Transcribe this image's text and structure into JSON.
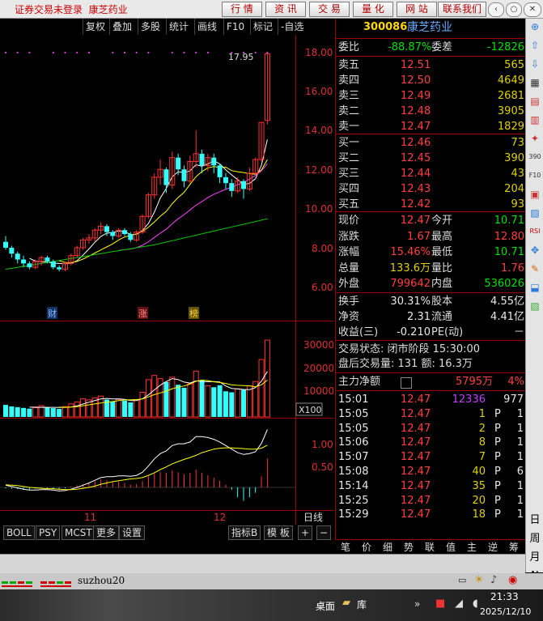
{
  "titlebar": {
    "status": "证券交易未登录",
    "stock_name": "康芝药业",
    "nav": [
      "行 情",
      "资 讯",
      "交 易",
      "量 化",
      "网 站",
      "联系我们"
    ],
    "win_controls": [
      "‹",
      "○",
      "□",
      "✕"
    ]
  },
  "toolbar": {
    "items": [
      "复权",
      "叠加",
      "多股",
      "统计",
      "画线",
      "F10",
      "标记",
      "-自选"
    ]
  },
  "chart": {
    "price_axis": [
      "18.00",
      "16.00",
      "14.00",
      "12.00",
      "10.00",
      "8.00",
      "6.00"
    ],
    "peak_label": "17.95",
    "markers": [
      "财",
      "涨",
      "榜"
    ],
    "volume_axis": [
      "30000",
      "20000",
      "10000"
    ],
    "volume_unit": "X100",
    "macd_axis": [
      "1.00",
      "0.50"
    ],
    "month_labels": [
      "11",
      "12"
    ],
    "period": "日线"
  },
  "chart_data": {
    "type": "candlestick",
    "candles": [
      {
        "o": 8.3,
        "c": 8.0,
        "h": 8.6,
        "l": 7.9
      },
      {
        "o": 8.0,
        "c": 7.7,
        "h": 8.1,
        "l": 7.5
      },
      {
        "o": 7.7,
        "c": 7.4,
        "h": 7.8,
        "l": 7.2
      },
      {
        "o": 7.4,
        "c": 7.2,
        "h": 7.6,
        "l": 7.0
      },
      {
        "o": 7.2,
        "c": 7.0,
        "h": 7.3,
        "l": 6.9
      },
      {
        "o": 7.0,
        "c": 7.3,
        "h": 7.4,
        "l": 6.9
      },
      {
        "o": 7.3,
        "c": 7.5,
        "h": 7.6,
        "l": 7.1
      },
      {
        "o": 7.5,
        "c": 7.3,
        "h": 7.6,
        "l": 7.2
      },
      {
        "o": 7.3,
        "c": 7.0,
        "h": 7.4,
        "l": 6.9
      },
      {
        "o": 7.0,
        "c": 6.9,
        "h": 7.1,
        "l": 6.8
      },
      {
        "o": 6.9,
        "c": 7.2,
        "h": 7.3,
        "l": 6.8
      },
      {
        "o": 7.2,
        "c": 7.6,
        "h": 7.7,
        "l": 7.1
      },
      {
        "o": 7.6,
        "c": 8.0,
        "h": 8.1,
        "l": 7.5
      },
      {
        "o": 8.0,
        "c": 8.4,
        "h": 8.5,
        "l": 7.9
      },
      {
        "o": 8.4,
        "c": 8.5,
        "h": 8.7,
        "l": 8.2
      },
      {
        "o": 8.5,
        "c": 8.9,
        "h": 9.0,
        "l": 8.3
      },
      {
        "o": 8.9,
        "c": 9.1,
        "h": 9.3,
        "l": 8.7
      },
      {
        "o": 9.1,
        "c": 8.8,
        "h": 9.2,
        "l": 8.6
      },
      {
        "o": 8.8,
        "c": 8.6,
        "h": 8.9,
        "l": 8.4
      },
      {
        "o": 8.6,
        "c": 8.9,
        "h": 9.0,
        "l": 8.5
      },
      {
        "o": 8.9,
        "c": 8.7,
        "h": 9.0,
        "l": 8.6
      },
      {
        "o": 8.7,
        "c": 8.4,
        "h": 8.8,
        "l": 8.3
      },
      {
        "o": 8.4,
        "c": 8.8,
        "h": 8.9,
        "l": 8.3
      },
      {
        "o": 8.8,
        "c": 9.6,
        "h": 9.7,
        "l": 8.7
      },
      {
        "o": 9.6,
        "c": 10.7,
        "h": 10.8,
        "l": 9.5
      },
      {
        "o": 10.7,
        "c": 11.6,
        "h": 11.8,
        "l": 10.5
      },
      {
        "o": 11.6,
        "c": 12.0,
        "h": 12.5,
        "l": 11.2
      },
      {
        "o": 12.0,
        "c": 11.2,
        "h": 12.1,
        "l": 10.8
      },
      {
        "o": 11.2,
        "c": 12.6,
        "h": 12.9,
        "l": 11.0
      },
      {
        "o": 12.6,
        "c": 12.0,
        "h": 12.8,
        "l": 11.7
      },
      {
        "o": 12.0,
        "c": 11.4,
        "h": 12.2,
        "l": 11.1
      },
      {
        "o": 11.4,
        "c": 12.4,
        "h": 12.7,
        "l": 11.3
      },
      {
        "o": 12.4,
        "c": 12.8,
        "h": 14.0,
        "l": 12.1
      },
      {
        "o": 12.8,
        "c": 12.2,
        "h": 13.0,
        "l": 11.8
      },
      {
        "o": 12.2,
        "c": 12.6,
        "h": 12.8,
        "l": 11.9
      },
      {
        "o": 12.6,
        "c": 12.2,
        "h": 12.8,
        "l": 11.8
      },
      {
        "o": 12.2,
        "c": 11.6,
        "h": 12.3,
        "l": 11.3
      },
      {
        "o": 11.6,
        "c": 11.3,
        "h": 11.8,
        "l": 11.0
      },
      {
        "o": 11.3,
        "c": 10.9,
        "h": 11.5,
        "l": 10.6
      },
      {
        "o": 10.9,
        "c": 11.4,
        "h": 11.6,
        "l": 10.8
      },
      {
        "o": 11.4,
        "c": 11.0,
        "h": 11.5,
        "l": 10.5
      },
      {
        "o": 11.0,
        "c": 11.8,
        "h": 12.1,
        "l": 10.9
      },
      {
        "o": 11.8,
        "c": 12.5,
        "h": 12.6,
        "l": 11.7
      },
      {
        "o": 12.5,
        "c": 14.4,
        "h": 14.4,
        "l": 12.4
      },
      {
        "o": 14.5,
        "c": 17.9,
        "h": 17.95,
        "l": 14.3
      }
    ],
    "volumes": [
      4800,
      4200,
      3900,
      3600,
      3300,
      4000,
      4500,
      3800,
      3500,
      3200,
      4100,
      5200,
      6000,
      7200,
      6800,
      7600,
      8300,
      6900,
      6200,
      7000,
      6500,
      5800,
      6900,
      9800,
      14800,
      16500,
      15200,
      13900,
      15800,
      12800,
      11600,
      13200,
      18200,
      14600,
      12400,
      11800,
      12600,
      10200,
      9800,
      11200,
      10800,
      12300,
      14100,
      22800,
      30500
    ],
    "vol_axis_max": 36000,
    "macd_hist": [
      -0.02,
      -0.03,
      -0.04,
      -0.05,
      -0.05,
      -0.03,
      -0.01,
      -0.02,
      -0.04,
      -0.05,
      -0.02,
      0.02,
      0.05,
      0.08,
      0.1,
      0.14,
      0.18,
      0.16,
      0.12,
      0.13,
      0.1,
      0.06,
      0.08,
      0.15,
      0.25,
      0.32,
      0.35,
      0.33,
      0.38,
      0.34,
      0.3,
      0.33,
      0.4,
      0.32,
      0.27,
      0.22,
      0.15,
      0.06,
      -0.05,
      -0.22,
      -0.3,
      -0.22,
      -0.12,
      0.25,
      0.65
    ],
    "dif": [
      0.05,
      0.02,
      -0.01,
      -0.04,
      -0.06,
      -0.06,
      -0.05,
      -0.05,
      -0.06,
      -0.08,
      -0.07,
      -0.04,
      0.0,
      0.05,
      0.1,
      0.16,
      0.22,
      0.24,
      0.24,
      0.26,
      0.26,
      0.25,
      0.27,
      0.34,
      0.48,
      0.64,
      0.76,
      0.82,
      0.94,
      0.98,
      0.98,
      1.02,
      1.14,
      1.14,
      1.12,
      1.08,
      1.02,
      0.94,
      0.86,
      0.78,
      0.74,
      0.76,
      0.8,
      0.99,
      1.3
    ],
    "dea": [
      0.06,
      0.05,
      0.04,
      0.02,
      0.0,
      -0.01,
      -0.02,
      -0.03,
      -0.03,
      -0.04,
      -0.05,
      -0.05,
      -0.04,
      -0.02,
      0.0,
      0.03,
      0.07,
      0.1,
      0.13,
      0.15,
      0.17,
      0.19,
      0.2,
      0.22,
      0.27,
      0.33,
      0.4,
      0.46,
      0.53,
      0.58,
      0.63,
      0.67,
      0.72,
      0.78,
      0.82,
      0.86,
      0.88,
      0.89,
      0.89,
      0.88,
      0.87,
      0.86,
      0.86,
      0.88,
      0.95
    ]
  },
  "quote": {
    "code": "300086",
    "name": "康芝药业",
    "weibi_label": "委比",
    "weibi": "-88.87%",
    "weicha_label": "委差",
    "weicha": "-12826",
    "asks": [
      {
        "label": "卖五",
        "price": "12.51",
        "vol": "565"
      },
      {
        "label": "卖四",
        "price": "12.50",
        "vol": "4649"
      },
      {
        "label": "卖三",
        "price": "12.49",
        "vol": "2681"
      },
      {
        "label": "卖二",
        "price": "12.48",
        "vol": "3905"
      },
      {
        "label": "卖一",
        "price": "12.47",
        "vol": "1829"
      }
    ],
    "bids": [
      {
        "label": "买一",
        "price": "12.46",
        "vol": "73"
      },
      {
        "label": "买二",
        "price": "12.45",
        "vol": "390"
      },
      {
        "label": "买三",
        "price": "12.44",
        "vol": "43"
      },
      {
        "label": "买四",
        "price": "12.43",
        "vol": "204"
      },
      {
        "label": "买五",
        "price": "12.42",
        "vol": "93"
      }
    ],
    "stats": [
      {
        "l1": "现价",
        "v1": "12.47",
        "l2": "今开",
        "v2": "10.71",
        "c1": "red",
        "c2": "green"
      },
      {
        "l1": "涨跌",
        "v1": "1.67",
        "l2": "最高",
        "v2": "12.80",
        "c1": "red",
        "c2": "red"
      },
      {
        "l1": "涨幅",
        "v1": "15.46%",
        "l2": "最低",
        "v2": "10.71",
        "c1": "red",
        "c2": "green"
      },
      {
        "l1": "总量",
        "v1": "133.6万",
        "l2": "量比",
        "v2": "1.76",
        "c1": "yellow",
        "c2": "red"
      },
      {
        "l1": "外盘",
        "v1": "799642",
        "l2": "内盘",
        "v2": "536026",
        "c1": "red",
        "c2": "green"
      }
    ],
    "fin": [
      {
        "l1": "换手",
        "v1": "30.31%",
        "l2": "股本",
        "v2": "4.55亿"
      },
      {
        "l1": "净资",
        "v1": "2.31",
        "l2": "流通",
        "v2": "4.41亿"
      },
      {
        "l1": "收益(三)",
        "v1": "-0.210",
        "l2": "PE(动)",
        "v2": "－"
      }
    ],
    "trade_state": "交易状态: 闭市阶段 15:30:00",
    "after_hours": "盘后交易量: 131  额: 16.3万",
    "main_net_label": "主力净额",
    "main_net": "5795万",
    "main_net_pct": "4%",
    "ticks": [
      {
        "t": "15:01",
        "p": "12.47",
        "v": "12336",
        "f": "",
        "n": "977",
        "vc": "purple"
      },
      {
        "t": "15:05",
        "p": "12.47",
        "v": "1",
        "f": "P",
        "n": "1",
        "vc": "yellow"
      },
      {
        "t": "15:05",
        "p": "12.47",
        "v": "2",
        "f": "P",
        "n": "1",
        "vc": "yellow"
      },
      {
        "t": "15:06",
        "p": "12.47",
        "v": "8",
        "f": "P",
        "n": "1",
        "vc": "yellow"
      },
      {
        "t": "15:07",
        "p": "12.47",
        "v": "7",
        "f": "P",
        "n": "1",
        "vc": "yellow"
      },
      {
        "t": "15:08",
        "p": "12.47",
        "v": "40",
        "f": "P",
        "n": "6",
        "vc": "yellow"
      },
      {
        "t": "15:14",
        "p": "12.47",
        "v": "35",
        "f": "P",
        "n": "1",
        "vc": "yellow"
      },
      {
        "t": "15:25",
        "p": "12.47",
        "v": "20",
        "f": "P",
        "n": "1",
        "vc": "yellow"
      },
      {
        "t": "15:29",
        "p": "12.47",
        "v": "18",
        "f": "P",
        "n": "1",
        "vc": "yellow"
      }
    ]
  },
  "bottom_tabs": [
    "BOLL",
    "PSY",
    "MCST",
    "更多",
    "设置"
  ],
  "bottom_right_tabs": [
    "指标B",
    "模 板",
    "+",
    "−"
  ],
  "quote_tabs": [
    "笔",
    "价",
    "细",
    "势",
    "联",
    "值",
    "主",
    "逆",
    "筹"
  ],
  "sidebar": {
    "icons": [
      "⊕",
      "⇧",
      "⇩",
      "▦",
      "▤",
      "▥",
      "✦",
      "390",
      "F10",
      "▣",
      "▨",
      "RSI",
      "✥",
      "✎",
      "⬓",
      "▧"
    ],
    "text": [
      "日",
      "周",
      "月",
      "N"
    ]
  },
  "status_bar": {
    "user": "suzhou20"
  },
  "taskbar": {
    "desktop": "桌面",
    "lib": "库",
    "time": "21:33",
    "date": "2025/12/10"
  }
}
